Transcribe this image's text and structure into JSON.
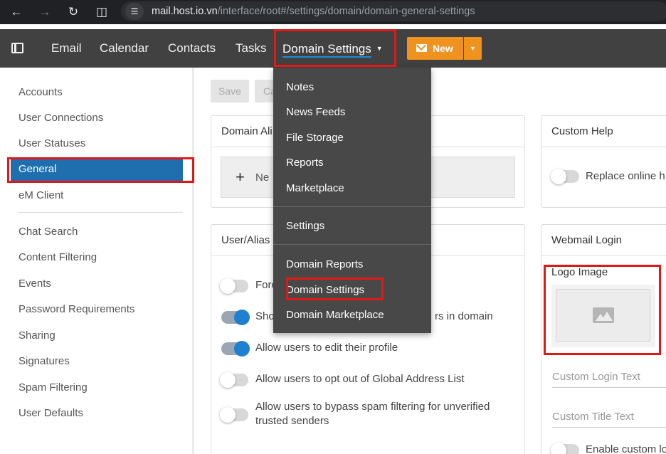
{
  "browser": {
    "url_host": "mail.host.io.vn",
    "url_path": "/interface/root#/settings/domain/domain-general-settings"
  },
  "nav": {
    "items": [
      "Email",
      "Calendar",
      "Contacts",
      "Tasks"
    ],
    "active_menu": "Domain Settings",
    "new_button": "New"
  },
  "sidebar": {
    "group1": [
      "Accounts",
      "User Connections",
      "User Statuses",
      "General",
      "eM Client"
    ],
    "group2": [
      "Chat Search",
      "Content Filtering",
      "Events",
      "Password Requirements",
      "Sharing",
      "Signatures",
      "Spam Filtering",
      "User Defaults"
    ],
    "active": "General"
  },
  "toolbar": {
    "save": "Save",
    "cancel_partial": "Ca"
  },
  "cards": {
    "domain_aliases": "Domain Ali",
    "domain_aliases_new": "Ne",
    "user_alias": "User/Alias",
    "custom_help": "Custom Help",
    "replace_online_help": "Replace online h",
    "webmail_login": "Webmail Login"
  },
  "user_options": [
    {
      "label": "Forc",
      "on": false
    },
    {
      "label": "Sho",
      "label_right": "rs in domain",
      "on": true
    },
    {
      "label": "Allow users to edit their profile",
      "on": true
    },
    {
      "label": "Allow users to opt out of Global Address List",
      "on": false
    },
    {
      "label": "Allow users to bypass spam filtering for unverified",
      "label_line2": "trusted senders",
      "on": false
    }
  ],
  "webmail": {
    "logo_label": "Logo Image",
    "custom_login_text": "Custom Login Text",
    "custom_title_text": "Custom Title Text",
    "enable_custom": "Enable custom lo"
  },
  "dropdown": {
    "group1": [
      "Notes",
      "News Feeds",
      "File Storage",
      "Reports",
      "Marketplace"
    ],
    "group2": [
      "Settings"
    ],
    "group3": [
      "Domain Reports",
      "Domain Settings",
      "Domain Marketplace"
    ]
  },
  "colors": {
    "nav_bg": "#414141",
    "active_blue": "#1f6fae",
    "new_orange": "#f0921e",
    "highlight_red": "#e01818",
    "dropdown_bg": "#484848"
  }
}
